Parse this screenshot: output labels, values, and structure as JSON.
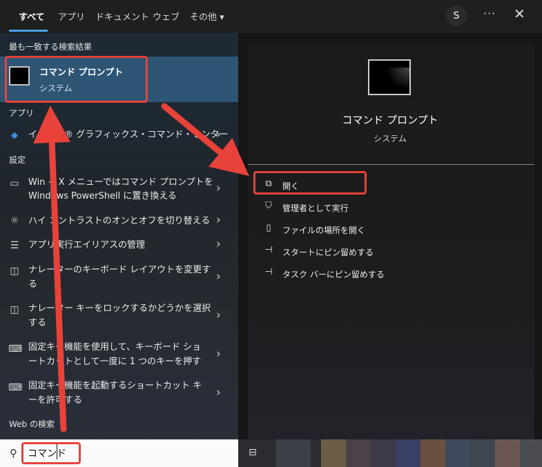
{
  "tabs": [
    {
      "label": "すべて",
      "active": true
    },
    {
      "label": "アプリ"
    },
    {
      "label": "ドキュメント"
    },
    {
      "label": "ウェブ"
    },
    {
      "label": "その他 ▾"
    }
  ],
  "header": {
    "avatar_letter": "S",
    "more": "···",
    "close": "✕"
  },
  "best_match": {
    "section_label": "最も一致する検索結果",
    "title": "コマンド プロンプト",
    "subtitle": "システム"
  },
  "apps": {
    "section_label": "アプリ",
    "items": [
      {
        "text": "インテル® グラフィックス・コマンド・センター",
        "icon": "intel-graphics-icon"
      }
    ]
  },
  "settings": {
    "section_label": "設定",
    "items": [
      {
        "line1": "Win + X メニューではコマンド プロンプトを",
        "line2": "Windows PowerShell に置き換える",
        "icon": "monitor-icon"
      },
      {
        "line1": "ハイ コントラストのオンとオフを切り替える",
        "line2": "",
        "icon": "brightness-icon"
      },
      {
        "line1": "アプリ実行エイリアスの管理",
        "line2": "",
        "icon": "list-icon"
      },
      {
        "line1": "ナレーターのキーボード レイアウトを変更す",
        "line2": "る",
        "icon": "narrator-icon"
      },
      {
        "line1": "ナレーター キーをロックするかどうかを選択",
        "line2": "する",
        "icon": "narrator-icon"
      },
      {
        "line1": "固定キー機能を使用して、キーボード ショ",
        "line2": "ートカットとして一度に 1 つのキーを押す",
        "icon": "keyboard-icon"
      },
      {
        "line1": "固定キー機能を起動するショートカット キ",
        "line2": "ーを許可する",
        "icon": "keyboard-icon"
      }
    ]
  },
  "web": {
    "section_label": "Web の検索"
  },
  "search": {
    "value": "コマンド"
  },
  "preview": {
    "title": "コマンド プロンプト",
    "subtitle": "システム",
    "actions": [
      {
        "label": "開く",
        "icon": "open-icon"
      },
      {
        "label": "管理者として実行",
        "icon": "shield-icon"
      },
      {
        "label": "ファイルの場所を開く",
        "icon": "file-location-icon"
      },
      {
        "label": "スタートにピン留めする",
        "icon": "pin-icon"
      },
      {
        "label": "タスク バーにピン留めする",
        "icon": "pin-icon"
      }
    ]
  },
  "colors": {
    "accent": "#4aa3f0",
    "selection": "#2e5574",
    "annotation": "#e8423a"
  }
}
